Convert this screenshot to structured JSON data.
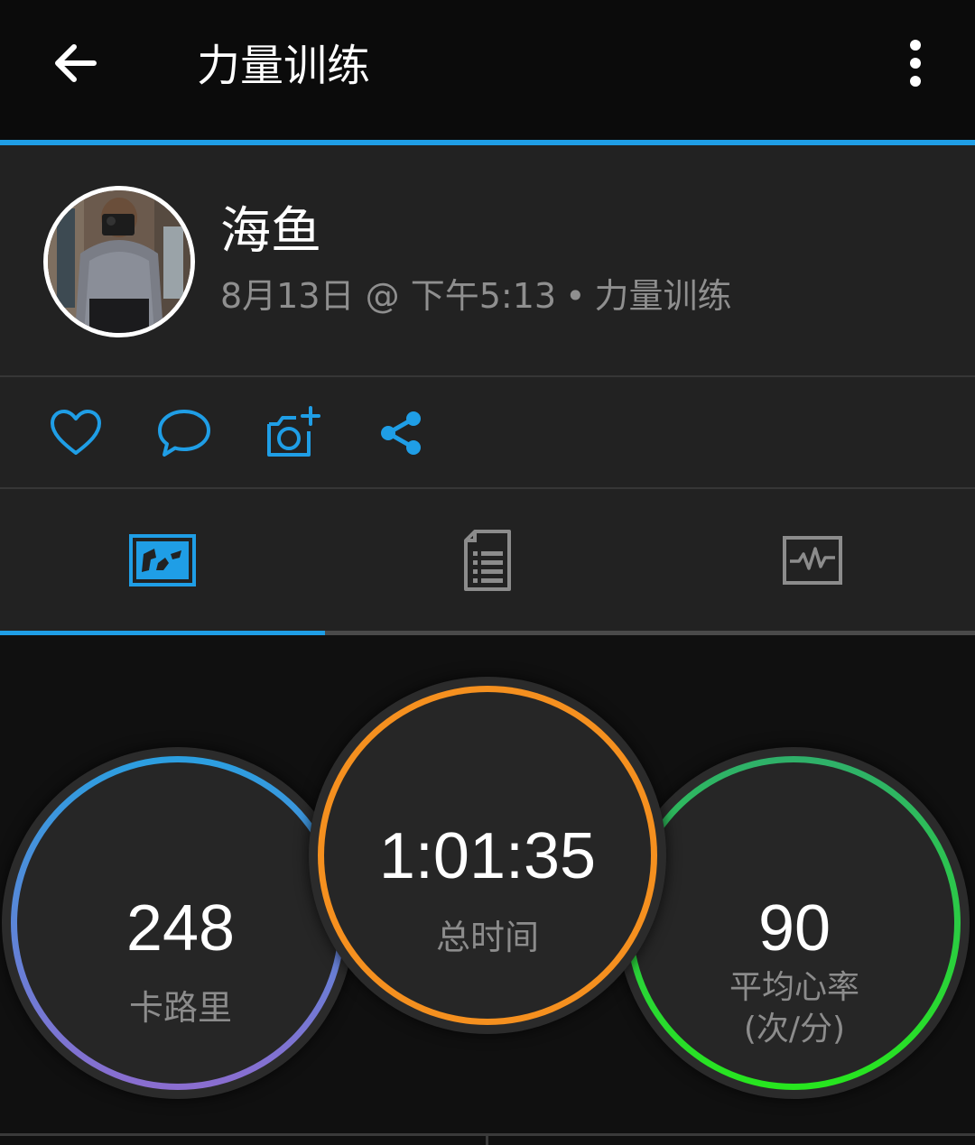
{
  "app_bar": {
    "title": "力量训练",
    "back_icon": "arrow-left-icon",
    "more_icon": "more-vertical-icon",
    "accent_color": "#1f9ee6"
  },
  "activity": {
    "user_name": "海鱼",
    "date": "8月13日",
    "at_symbol": "@",
    "time": "下午5:13",
    "separator": "•",
    "type": "力量训练"
  },
  "actions": [
    {
      "icon": "heart-icon",
      "label": "like"
    },
    {
      "icon": "comment-icon",
      "label": "comment"
    },
    {
      "icon": "add-photo-icon",
      "label": "add photo"
    },
    {
      "icon": "share-icon",
      "label": "share"
    }
  ],
  "tabs": [
    {
      "icon": "overview-icon",
      "selected": true
    },
    {
      "icon": "details-list-icon",
      "selected": false
    },
    {
      "icon": "heart-rate-chart-icon",
      "selected": false
    }
  ],
  "stats": {
    "calories": {
      "value": "248",
      "label": "卡路里",
      "gradient": [
        "#2b9fe0",
        "#8b6dd0"
      ]
    },
    "total_time": {
      "value": "1:01:35",
      "label": "总时间",
      "color": "#f5901f"
    },
    "avg_hr": {
      "value": "90",
      "label_line1": "平均心率",
      "label_line2": "(次/分)",
      "gradient": [
        "#2fb06a",
        "#27e61e"
      ]
    }
  }
}
